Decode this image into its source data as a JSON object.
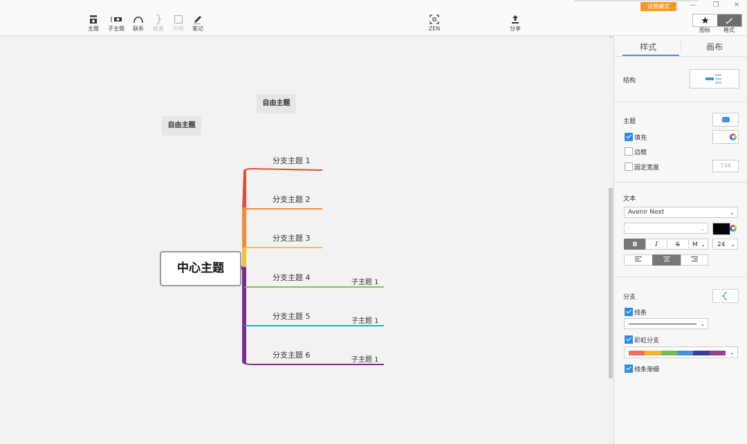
{
  "toolbar": {
    "topic": "主题",
    "subtopic": "子主题",
    "relationship": "联系",
    "summary": "概要",
    "boundary": "外框",
    "notes": "笔记",
    "zen": "ZEN",
    "share": "分享",
    "trial_mode": "试用模式",
    "icon": "图标",
    "format": "格式"
  },
  "canvas": {
    "central_topic": "中心主题",
    "free_topics": [
      "自由主题",
      "自由主题"
    ],
    "branches": [
      {
        "label": "分支主题 1",
        "color": "#e64a3b",
        "children": []
      },
      {
        "label": "分支主题 2",
        "color": "#f08c3a",
        "children": []
      },
      {
        "label": "分支主题 3",
        "color": "#f5c13c",
        "children": []
      },
      {
        "label": "分支主题 4",
        "color": "#8bc34a",
        "children": [
          "子主题 1"
        ]
      },
      {
        "label": "分支主题 5",
        "color": "#2fa8cf",
        "children": [
          "子主题 1"
        ]
      },
      {
        "label": "分支主题 6",
        "color": "#7b2d8b",
        "children": [
          "子主题 1"
        ]
      }
    ]
  },
  "panel": {
    "tab_style": "样式",
    "tab_canvas": "画布",
    "structure_label": "结构",
    "topic_label": "主题",
    "fill_label": "填充",
    "border_label": "边框",
    "fixed_width_label": "固定宽度",
    "fixed_width_value": "154",
    "text_label": "文本",
    "font_family": "Avenir Next",
    "font_weight": "-",
    "bold": "B",
    "italic": "I",
    "strike": "S",
    "more": "M",
    "font_size": "24",
    "branch_label": "分支",
    "line_label": "线条",
    "rainbow_label": "彩虹分支",
    "taper_label": "线条渐细",
    "fill_checked": true,
    "border_checked": false,
    "fixed_width_checked": false,
    "line_checked": true,
    "rainbow_checked": true,
    "taper_checked": true,
    "rainbow_colors": [
      "#f26b5b",
      "#f5b430",
      "#6fbf50",
      "#4a8fd8",
      "#3b3b9a",
      "#9b3d8e"
    ]
  }
}
